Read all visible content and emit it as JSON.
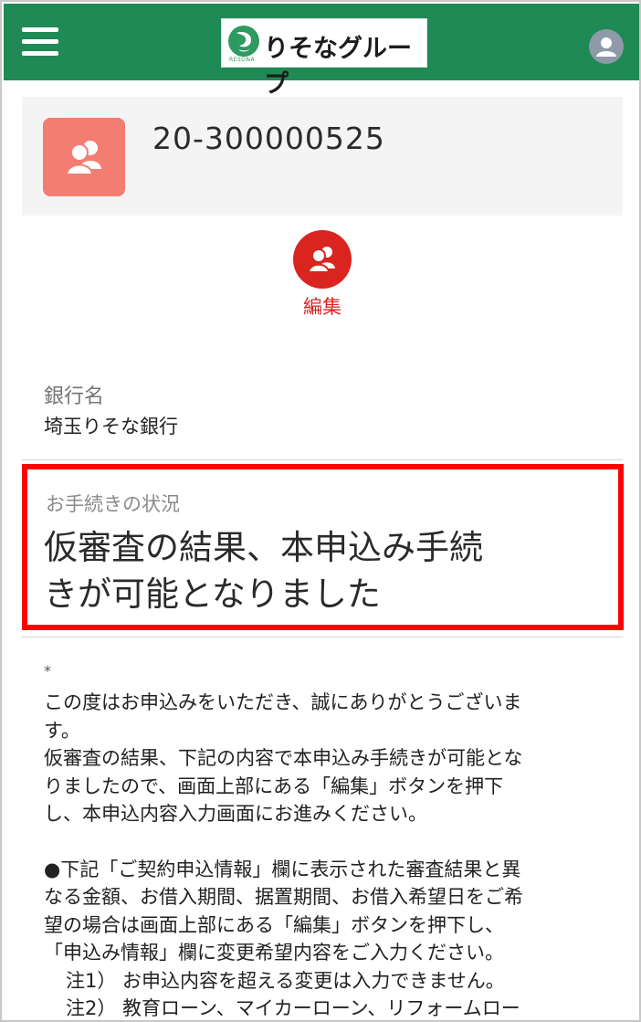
{
  "header": {
    "logo_text": "りそなグループ",
    "logo_sub": "RESONA",
    "brand_color": "#1f8a55"
  },
  "account": {
    "number": "20-300000525"
  },
  "actions": {
    "edit_label": "編集"
  },
  "bank": {
    "label": "銀行名",
    "value": "埼玉りそな銀行"
  },
  "status": {
    "label": "お手続きの状況",
    "value_line1": "仮審査の結果、本申込み手続",
    "value_line2": "きが可能となりました",
    "highlight_color": "#ff0000"
  },
  "notes": {
    "asterisk": "*",
    "lines": [
      "この度はお申込みをいただき、誠にありがとうございま",
      "す。",
      "仮審査の結果、下記の内容で本申込み手続きが可能とな",
      "りましたので、画面上部にある「編集」ボタンを押下",
      "し、本申込内容入力画面にお進みください。",
      "●下記「ご契約申込情報」欄に表示された審査結果と異",
      "なる金額、お借入期間、据置期間、お借入希望日をご希",
      "望の場合は画面上部にある「編集」ボタンを押下し、",
      "「申込み情報」欄に変更希望内容をご入力ください。",
      "注1） お申込内容を超える変更は入力できません。",
      "注2） 教育ローン、マイカーローン、リフォームロー"
    ]
  }
}
